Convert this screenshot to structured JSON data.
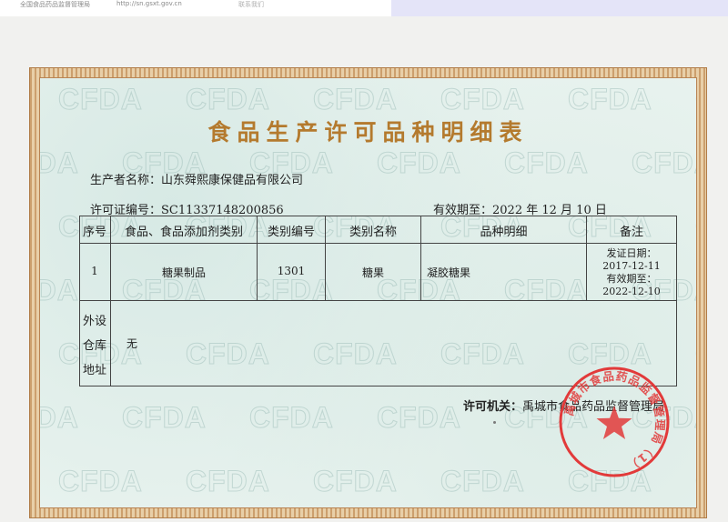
{
  "browser_strip": {
    "left_text": "全国食品药品监督管理局",
    "url_text": "http://sn.gsxt.gov.cn",
    "right_text": "联系我们"
  },
  "certificate": {
    "title": "食品生产许可品种明细表",
    "watermark_text": "CFDA",
    "producer": {
      "label": "生产者名称：",
      "value": "山东舜熙康保健品有限公司"
    },
    "license": {
      "label": "许可证编号：",
      "value": "SC11337148200856"
    },
    "validity": {
      "label": "有效期至：",
      "value": "2022 年 12 月 10 日"
    },
    "table": {
      "headers": [
        "序号",
        "食品、食品添加剂类别",
        "类别编号",
        "类别名称",
        "品种明细",
        "备注"
      ],
      "rows": [
        {
          "index": "1",
          "category": "糖果制品",
          "code": "1301",
          "name": "糖果",
          "detail": "凝胶糖果",
          "remark_lines": [
            "发证日期：",
            "2017-12-11",
            "有效期至：",
            "2022-12-10"
          ]
        }
      ],
      "warehouse_label_lines": [
        "外设",
        "仓库",
        "地址"
      ],
      "warehouse_value": "无"
    },
    "authority": {
      "label": "许可机关：",
      "value": "禹城市食品药品监督管理局"
    },
    "seal": {
      "ring_text": "禹城市食品药品监督管理局（1）",
      "color": "#e23a3a"
    }
  }
}
